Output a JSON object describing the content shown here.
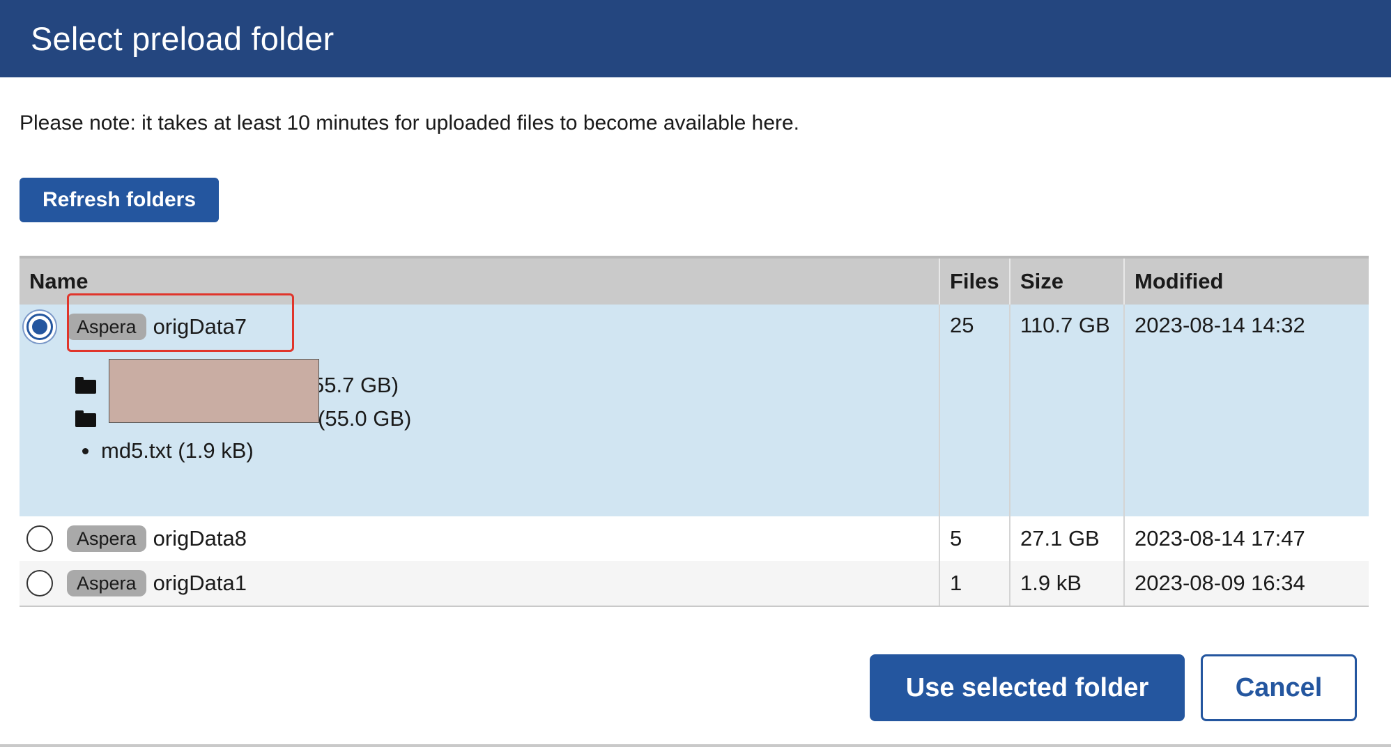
{
  "dialog": {
    "title": "Select preload folder",
    "note": "Please note: it takes at least 10 minutes for uploaded files to become available here.",
    "refresh_label": "Refresh folders"
  },
  "table": {
    "headers": {
      "name": "Name",
      "files": "Files",
      "size": "Size",
      "modified": "Modified"
    },
    "rows": [
      {
        "badge": "Aspera",
        "name": "origData7",
        "files": "25",
        "size": "110.7 GB",
        "modified": "2023-08-14 14:32",
        "selected": true,
        "subfolders": [
          "55.7 GB)",
          "(55.0 GB)"
        ],
        "subfiles": [
          "md5.txt (1.9 kB)"
        ]
      },
      {
        "badge": "Aspera",
        "name": "origData8",
        "files": "5",
        "size": "27.1 GB",
        "modified": "2023-08-14 17:47",
        "selected": false
      },
      {
        "badge": "Aspera",
        "name": "origData1",
        "files": "1",
        "size": "1.9 kB",
        "modified": "2023-08-09 16:34",
        "selected": false
      }
    ]
  },
  "footer": {
    "use_label": "Use selected folder",
    "cancel_label": "Cancel"
  },
  "colors": {
    "header_bg": "#24467f",
    "primary": "#24569f",
    "selected_row": "#d1e5f2",
    "highlight": "#e0352b",
    "redaction": "#c9ada3"
  }
}
